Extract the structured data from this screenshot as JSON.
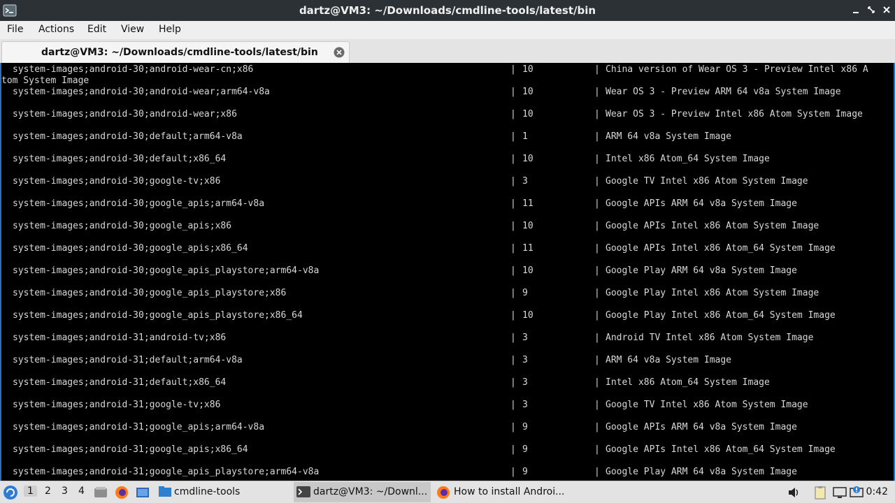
{
  "window": {
    "title": "dartz@VM3: ~/Downloads/cmdline-tools/latest/bin",
    "controls": [
      "minimize-icon",
      "restore-icon",
      "close-icon"
    ]
  },
  "menu": {
    "items": [
      "File",
      "Actions",
      "Edit",
      "View",
      "Help"
    ]
  },
  "tab": {
    "label": "dartz@VM3: ~/Downloads/cmdline-tools/latest/bin"
  },
  "terminal": {
    "wrap_first": "tom System Image",
    "rows": [
      {
        "path": "system-images;android-30;android-wear-cn;x86",
        "rev": "10",
        "desc": "China version of Wear OS 3 - Preview Intel x86 A"
      },
      {
        "path": "system-images;android-30;android-wear;arm64-v8a",
        "rev": "10",
        "desc": "Wear OS 3 - Preview ARM 64 v8a System Image"
      },
      {
        "path": "system-images;android-30;android-wear;x86",
        "rev": "10",
        "desc": "Wear OS 3 - Preview Intel x86 Atom System Image"
      },
      {
        "path": "system-images;android-30;default;arm64-v8a",
        "rev": "1",
        "desc": "ARM 64 v8a System Image"
      },
      {
        "path": "system-images;android-30;default;x86_64",
        "rev": "10",
        "desc": "Intel x86 Atom_64 System Image"
      },
      {
        "path": "system-images;android-30;google-tv;x86",
        "rev": "3",
        "desc": "Google TV Intel x86 Atom System Image"
      },
      {
        "path": "system-images;android-30;google_apis;arm64-v8a",
        "rev": "11",
        "desc": "Google APIs ARM 64 v8a System Image"
      },
      {
        "path": "system-images;android-30;google_apis;x86",
        "rev": "10",
        "desc": "Google APIs Intel x86 Atom System Image"
      },
      {
        "path": "system-images;android-30;google_apis;x86_64",
        "rev": "11",
        "desc": "Google APIs Intel x86 Atom_64 System Image"
      },
      {
        "path": "system-images;android-30;google_apis_playstore;arm64-v8a",
        "rev": "10",
        "desc": "Google Play ARM 64 v8a System Image"
      },
      {
        "path": "system-images;android-30;google_apis_playstore;x86",
        "rev": "9",
        "desc": "Google Play Intel x86 Atom System Image"
      },
      {
        "path": "system-images;android-30;google_apis_playstore;x86_64",
        "rev": "10",
        "desc": "Google Play Intel x86 Atom_64 System Image"
      },
      {
        "path": "system-images;android-31;android-tv;x86",
        "rev": "3",
        "desc": "Android TV Intel x86 Atom System Image"
      },
      {
        "path": "system-images;android-31;default;arm64-v8a",
        "rev": "3",
        "desc": "ARM 64 v8a System Image"
      },
      {
        "path": "system-images;android-31;default;x86_64",
        "rev": "3",
        "desc": "Intel x86 Atom_64 System Image"
      },
      {
        "path": "system-images;android-31;google-tv;x86",
        "rev": "3",
        "desc": "Google TV Intel x86 Atom System Image"
      },
      {
        "path": "system-images;android-31;google_apis;arm64-v8a",
        "rev": "9",
        "desc": "Google APIs ARM 64 v8a System Image"
      },
      {
        "path": "system-images;android-31;google_apis;x86_64",
        "rev": "9",
        "desc": "Google APIs Intel x86 Atom_64 System Image"
      },
      {
        "path": "system-images;android-31;google_apis_playstore;arm64-v8a",
        "rev": "9",
        "desc": "Google Play ARM 64 v8a System Image"
      }
    ],
    "separator": "|"
  },
  "taskbar": {
    "workspaces": [
      "1",
      "2",
      "3",
      "4"
    ],
    "tasks": [
      {
        "label": "cmdline-tools",
        "icon": "folder-icon"
      },
      {
        "label": "dartz@VM3: ~/Downl...",
        "icon": "terminal-icon"
      },
      {
        "label": "How to install Androi...",
        "icon": "firefox-icon"
      }
    ],
    "clock": "0:42"
  }
}
